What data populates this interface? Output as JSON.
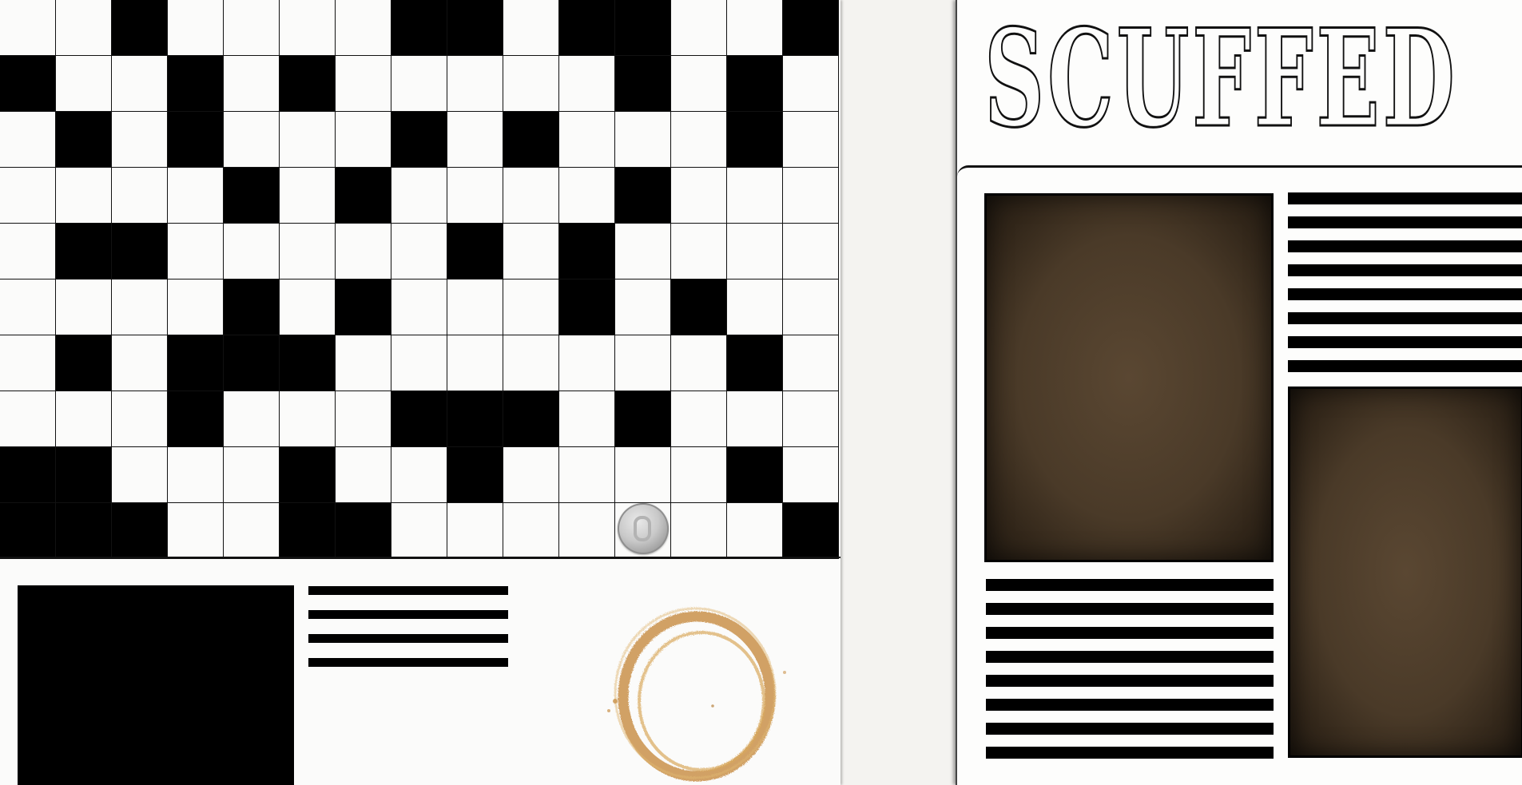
{
  "masthead": {
    "title": "SCUFFED"
  },
  "crossword": {
    "rows": 10,
    "cols": 15,
    "black_cells": [
      [
        0,
        2
      ],
      [
        0,
        7
      ],
      [
        0,
        8
      ],
      [
        0,
        10
      ],
      [
        0,
        11
      ],
      [
        0,
        14
      ],
      [
        1,
        0
      ],
      [
        1,
        3
      ],
      [
        1,
        5
      ],
      [
        1,
        11
      ],
      [
        1,
        13
      ],
      [
        2,
        1
      ],
      [
        2,
        3
      ],
      [
        2,
        7
      ],
      [
        2,
        9
      ],
      [
        2,
        13
      ],
      [
        3,
        4
      ],
      [
        3,
        6
      ],
      [
        3,
        11
      ],
      [
        4,
        1
      ],
      [
        4,
        2
      ],
      [
        4,
        8
      ],
      [
        4,
        10
      ],
      [
        5,
        4
      ],
      [
        5,
        6
      ],
      [
        5,
        10
      ],
      [
        5,
        12
      ],
      [
        6,
        1
      ],
      [
        6,
        3
      ],
      [
        6,
        4
      ],
      [
        6,
        5
      ],
      [
        6,
        13
      ],
      [
        7,
        3
      ],
      [
        7,
        7
      ],
      [
        7,
        8
      ],
      [
        7,
        9
      ],
      [
        7,
        11
      ],
      [
        8,
        0
      ],
      [
        8,
        1
      ],
      [
        8,
        5
      ],
      [
        8,
        8
      ],
      [
        8,
        13
      ],
      [
        9,
        0
      ],
      [
        9,
        1
      ],
      [
        9,
        2
      ],
      [
        9,
        5
      ],
      [
        9,
        6
      ],
      [
        9,
        14
      ]
    ]
  },
  "left_page": {
    "text_line_count": 4
  },
  "right_page": {
    "top_text_line_count": 8,
    "bottom_text_line_count": 8
  },
  "colors": {
    "paper": "#fbfbfa",
    "ink": "#000000",
    "photo_brown": "#4a3a28",
    "coffee_stain": "#c9924a",
    "coin": "#c9c9c9"
  },
  "objects": {
    "coin": "silver-coin",
    "stain": "coffee-ring-stain"
  }
}
